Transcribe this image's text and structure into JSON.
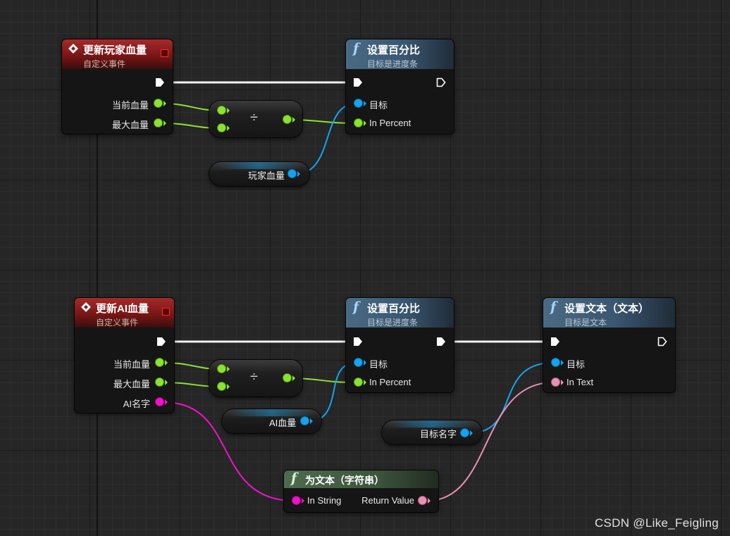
{
  "graph": {
    "top_event": {
      "title": "更新玩家血量",
      "subtitle": "自定义事件",
      "pins": [
        "当前血量",
        "最大血量"
      ]
    },
    "top_set_percent": {
      "title": "设置百分比",
      "subtitle": "目标是进度条",
      "pins": [
        "目标",
        "In Percent"
      ]
    },
    "top_divide": {
      "op": "÷"
    },
    "top_var": {
      "label": "玩家血量"
    },
    "bottom_event": {
      "title": "更新AI血量",
      "subtitle": "自定义事件",
      "pins": [
        "当前血量",
        "最大血量",
        "AI名字"
      ]
    },
    "bottom_set_percent": {
      "title": "设置百分比",
      "subtitle": "目标是进度条",
      "pins": [
        "目标",
        "In Percent"
      ]
    },
    "bottom_divide": {
      "op": "÷"
    },
    "bottom_var": {
      "label": "AI血量"
    },
    "set_text": {
      "title": "设置文本（文本）",
      "subtitle": "目标是文本",
      "pins": [
        "目标",
        "In Text"
      ]
    },
    "target_name_var": {
      "label": "目标名字"
    },
    "to_text": {
      "title": "为文本（字符串）",
      "input": "In String",
      "output": "Return Value"
    }
  },
  "watermark": "CSDN @Like_Feigling",
  "colors": {
    "exec": "#ffffff",
    "float": "#8be234",
    "object": "#15a3f0",
    "string": "#f012c8",
    "text": "#ea8fb4",
    "event_header": "#8b1a1a",
    "function_header": "#3d5a74",
    "pure_header": "#415a41"
  }
}
